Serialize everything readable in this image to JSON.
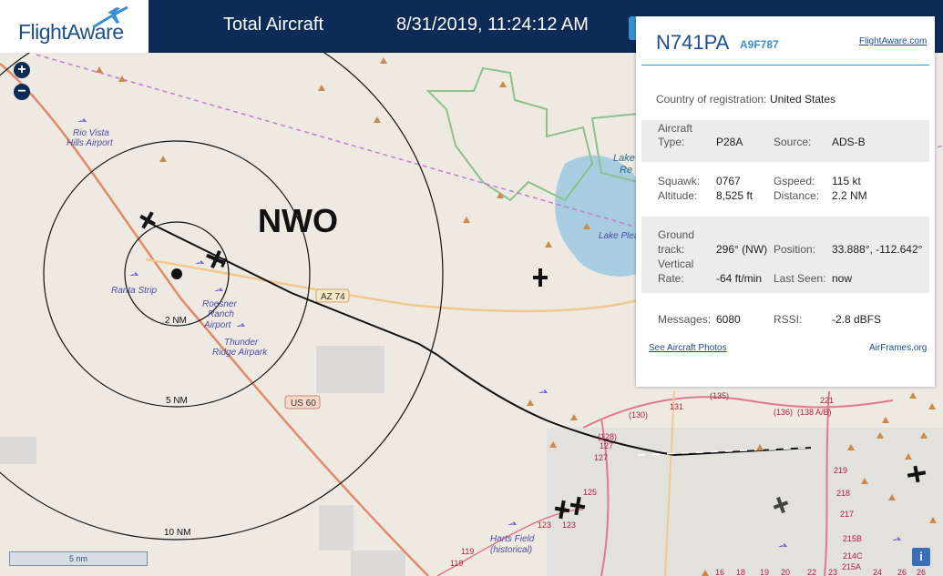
{
  "header": {
    "logo_text": "FlightAware",
    "total_label": "Total Aircraft",
    "timestamp": "8/31/2019, 11:24:12 AM"
  },
  "map": {
    "zoom_in": "+",
    "zoom_out": "−",
    "scale_label": "5 nm",
    "info_button": "i",
    "radar_label": "NWO",
    "rings": [
      "2 NM",
      "5 NM",
      "10 NM"
    ],
    "places": {
      "rio_vista": [
        "Rio Vista",
        "Hills Airport"
      ],
      "ranta": "Ranta Strip",
      "roesner": [
        "Roesner",
        "Ranch",
        "Airport"
      ],
      "thunder": [
        "Thunder",
        "Ridge Airpark"
      ],
      "harts": [
        "Harts Field",
        "(historical)"
      ],
      "lake": [
        "Lake",
        "Re"
      ],
      "lake_pleasant": "Lake Plea"
    },
    "shields": {
      "az74": "AZ 74",
      "us60": "US 60"
    },
    "road_numbers": [
      "(135)",
      "131",
      "(130)",
      "(136)",
      "(138 A/B)",
      "221",
      "(128)",
      "127",
      "127",
      "125",
      "123",
      "123",
      "119",
      "119",
      "219",
      "218",
      "217",
      "215B",
      "214C",
      "215A",
      "16",
      "18",
      "19",
      "20",
      "22",
      "23",
      "24",
      "26",
      "26"
    ]
  },
  "panel": {
    "registration": "N741PA",
    "hex_code": "A9F787",
    "fa_link": "FlightAware.com",
    "country_label": "Country of registration:",
    "country_value": "United States",
    "aircraft_type_label_1": "Aircraft",
    "aircraft_type_label_2": "Type:",
    "aircraft_type_value": "P28A",
    "source_label": "Source:",
    "source_value": "ADS-B",
    "squawk_label": "Squawk:",
    "squawk_value": "0767",
    "gspeed_label": "Gspeed:",
    "gspeed_value": "115 kt",
    "altitude_label": "Altitude:",
    "altitude_value": "8,525 ft",
    "distance_label": "Distance:",
    "distance_value": "2.2 NM",
    "track_label_1": "Ground",
    "track_label_2": "track:",
    "track_value": "296° (NW)",
    "position_label": "Position:",
    "position_value": "33.888°, -112.642°",
    "vrate_label_1": "Vertical",
    "vrate_label_2": "Rate:",
    "vrate_value": "-64 ft/min",
    "last_seen_label": "Last Seen:",
    "last_seen_value": "now",
    "messages_label": "Messages:",
    "messages_value": "6080",
    "rssi_label": "RSSI:",
    "rssi_value": "-2.8 dBFS",
    "photos_link": "See Aircraft Photos",
    "airframes_link": "AirFrames.org"
  },
  "colors": {
    "header_bg": "#0d2b57",
    "map_bg": "#eeeae2",
    "accent": "#3a8fd0",
    "park_border": "#8cc08c",
    "water": "#a9cde0",
    "highway": "#e08a6a"
  }
}
